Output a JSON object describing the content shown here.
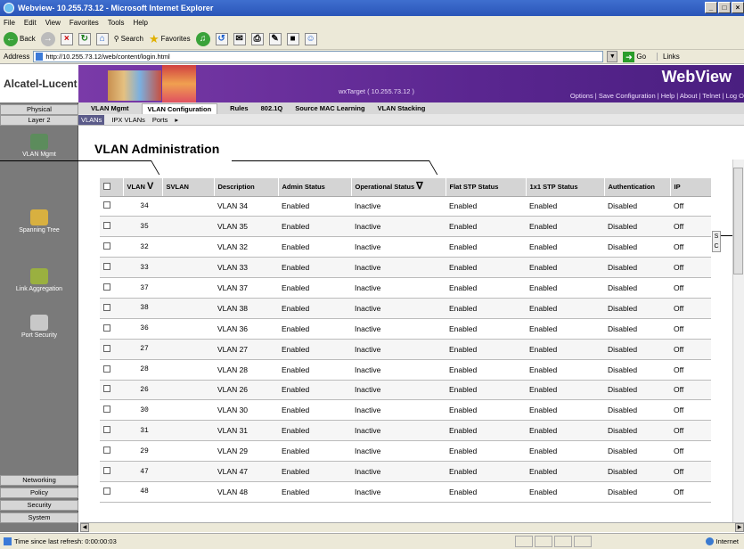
{
  "window": {
    "title": "Webview- 10.255.73.12 - Microsoft Internet Explorer",
    "controls": [
      "_",
      "□",
      "×"
    ]
  },
  "menu": [
    "File",
    "Edit",
    "View",
    "Favorites",
    "Tools",
    "Help"
  ],
  "toolbar": {
    "back": "Back",
    "search": "Search",
    "favorites": "Favorites"
  },
  "address": {
    "label": "Address",
    "url": "http://10.255.73.12/web/content/login.html",
    "go": "Go",
    "links": "Links"
  },
  "header": {
    "brand": "Alcatel-Lucent",
    "target": "wxTarget ( 10.255.73.12 )",
    "app": "WebView",
    "links": "Options | Save Configuration | Help | About | Telnet | Log O"
  },
  "nav": {
    "tabs": [
      "Physical",
      "VLAN Mgmt",
      "VLAN Configuration",
      "Rules",
      "802.1Q",
      "Source MAC Learning",
      "VLAN Stacking"
    ],
    "active": "VLAN Configuration"
  },
  "subnav": {
    "layer": "Layer 2",
    "tabs": [
      "VLANs",
      "IPX VLANs",
      "Ports"
    ]
  },
  "sidebar": {
    "items": [
      "VLAN Mgmt",
      "Spanning Tree",
      "Link Aggregation",
      "Port Security"
    ],
    "bottom": [
      "Networking",
      "Policy",
      "Security",
      "System"
    ]
  },
  "page": {
    "title": "VLAN Administration"
  },
  "table": {
    "columns": [
      "VLAN",
      "SVLAN",
      "Description",
      "Admin Status",
      "Operational Status",
      "Flat STP Status",
      "1x1 STP Status",
      "Authentication",
      "IP"
    ],
    "rows": [
      [
        "34",
        "",
        "VLAN 34",
        "Enabled",
        "Inactive",
        "Enabled",
        "Enabled",
        "Disabled",
        "Off"
      ],
      [
        "35",
        "",
        "VLAN 35",
        "Enabled",
        "Inactive",
        "Enabled",
        "Enabled",
        "Disabled",
        "Off"
      ],
      [
        "32",
        "",
        "VLAN 32",
        "Enabled",
        "Inactive",
        "Enabled",
        "Enabled",
        "Disabled",
        "Off"
      ],
      [
        "33",
        "",
        "VLAN 33",
        "Enabled",
        "Inactive",
        "Enabled",
        "Enabled",
        "Disabled",
        "Off"
      ],
      [
        "37",
        "",
        "VLAN 37",
        "Enabled",
        "Inactive",
        "Enabled",
        "Enabled",
        "Disabled",
        "Off"
      ],
      [
        "38",
        "",
        "VLAN 38",
        "Enabled",
        "Inactive",
        "Enabled",
        "Enabled",
        "Disabled",
        "Off"
      ],
      [
        "36",
        "",
        "VLAN 36",
        "Enabled",
        "Inactive",
        "Enabled",
        "Enabled",
        "Disabled",
        "Off"
      ],
      [
        "27",
        "",
        "VLAN 27",
        "Enabled",
        "Inactive",
        "Enabled",
        "Enabled",
        "Disabled",
        "Off"
      ],
      [
        "28",
        "",
        "VLAN 28",
        "Enabled",
        "Inactive",
        "Enabled",
        "Enabled",
        "Disabled",
        "Off"
      ],
      [
        "26",
        "",
        "VLAN 26",
        "Enabled",
        "Inactive",
        "Enabled",
        "Enabled",
        "Disabled",
        "Off"
      ],
      [
        "30",
        "",
        "VLAN 30",
        "Enabled",
        "Inactive",
        "Enabled",
        "Enabled",
        "Disabled",
        "Off"
      ],
      [
        "31",
        "",
        "VLAN 31",
        "Enabled",
        "Inactive",
        "Enabled",
        "Enabled",
        "Disabled",
        "Off"
      ],
      [
        "29",
        "",
        "VLAN 29",
        "Enabled",
        "Inactive",
        "Enabled",
        "Enabled",
        "Disabled",
        "Off"
      ],
      [
        "47",
        "",
        "VLAN 47",
        "Enabled",
        "Inactive",
        "Enabled",
        "Enabled",
        "Disabled",
        "Off"
      ],
      [
        "48",
        "",
        "VLAN 48",
        "Enabled",
        "Inactive",
        "Enabled",
        "Enabled",
        "Disabled",
        "Off"
      ]
    ]
  },
  "scroll_config": {
    "s": "S",
    "c": "C"
  },
  "status": {
    "text": "Time since last refresh: 0:00:00:03",
    "zone": "Internet"
  }
}
